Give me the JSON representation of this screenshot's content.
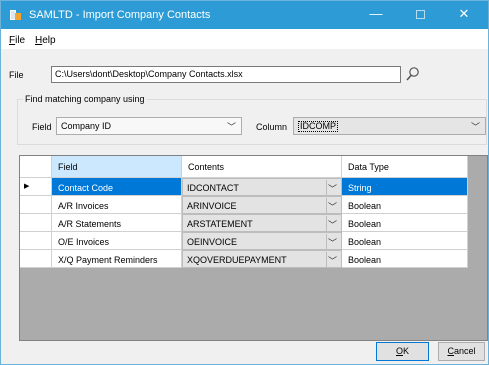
{
  "window": {
    "title": "SAMLTD - Import Company Contacts",
    "minimize_glyph": "—",
    "close_glyph": "✕"
  },
  "menu": {
    "file_accel": "F",
    "file_rest": "ile",
    "help_accel": "H",
    "help_rest": "elp"
  },
  "file_section": {
    "label": "File",
    "path": "C:\\Users\\dont\\Desktop\\Company Contacts.xlsx",
    "browse_icon": "magnifier-icon"
  },
  "match_group": {
    "title": "Find matching company using",
    "field_label": "Field",
    "field_value": "Company ID",
    "column_label": "Column",
    "column_value": "IDCOMP",
    "chevron_glyph": "﹀"
  },
  "grid": {
    "columns": [
      "Field",
      "Contents",
      "Data Type"
    ],
    "row_marker": "▶",
    "chevron_glyph": "﹀",
    "rows": [
      {
        "field": "Contact Code",
        "contents": "IDCONTACT",
        "data_type": "String"
      },
      {
        "field": "A/R Invoices",
        "contents": "ARINVOICE",
        "data_type": "Boolean"
      },
      {
        "field": "A/R Statements",
        "contents": "ARSTATEMENT",
        "data_type": "Boolean"
      },
      {
        "field": "O/E Invoices",
        "contents": "OEINVOICE",
        "data_type": "Boolean"
      },
      {
        "field": "X/Q Payment Reminders",
        "contents": "XQOVERDUEPAYMENT",
        "data_type": "Boolean"
      }
    ]
  },
  "buttons": {
    "ok_accel": "O",
    "ok_rest": "K",
    "cancel_accel": "C",
    "cancel_rest": "ancel"
  },
  "colors": {
    "titlebar": "#2d9cd6",
    "selection": "#0078d7",
    "selected_header": "#cce8ff"
  }
}
